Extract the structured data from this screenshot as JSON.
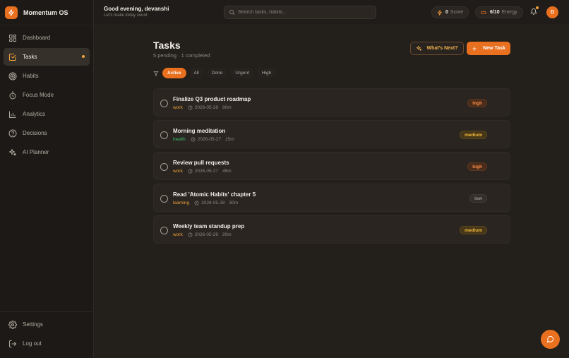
{
  "app": {
    "name": "Momentum OS"
  },
  "sidebar": {
    "items": [
      {
        "label": "Dashboard",
        "icon": "dashboard-icon",
        "active": false
      },
      {
        "label": "Tasks",
        "icon": "tasks-icon",
        "active": true
      },
      {
        "label": "Habits",
        "icon": "target-icon",
        "active": false
      },
      {
        "label": "Focus Mode",
        "icon": "timer-icon",
        "active": false
      },
      {
        "label": "Analytics",
        "icon": "analytics-icon",
        "active": false
      },
      {
        "label": "Decisions",
        "icon": "help-circle-icon",
        "active": false
      },
      {
        "label": "AI Planner",
        "icon": "sparkles-icon",
        "active": false
      }
    ],
    "bottom": [
      {
        "label": "Settings",
        "icon": "gear-icon"
      },
      {
        "label": "Log out",
        "icon": "logout-icon"
      }
    ]
  },
  "header": {
    "greeting": "Good evening, devanshi",
    "subtitle": "Let's make today count",
    "search_placeholder": "Search tasks, habits...",
    "score_value": "0",
    "score_label": "Score",
    "energy_value": "6/10",
    "energy_label": "Energy",
    "avatar_initial": "D"
  },
  "main": {
    "title": "Tasks",
    "subtitle": "5 pending · 1 completed",
    "whats_next_label": "What's Next?",
    "new_task_label": "New Task",
    "filters": [
      {
        "label": "Active",
        "active": true
      },
      {
        "label": "All",
        "active": false
      },
      {
        "label": "Done",
        "active": false
      },
      {
        "label": "Urgent",
        "active": false
      },
      {
        "label": "High",
        "active": false
      }
    ],
    "tasks": [
      {
        "title": "Finalize Q3 product roadmap",
        "category": "work",
        "date": "2026-05-28",
        "duration": "90m",
        "priority": "high"
      },
      {
        "title": "Morning meditation",
        "category": "health",
        "date": "2026-05-27",
        "duration": "15m",
        "priority": "medium"
      },
      {
        "title": "Review pull requests",
        "category": "work",
        "date": "2026-05-27",
        "duration": "45m",
        "priority": "high"
      },
      {
        "title": "Read 'Atomic Habits' chapter 5",
        "category": "learning",
        "date": "2026-05-28",
        "duration": "30m",
        "priority": "low"
      },
      {
        "title": "Weekly team standup prep",
        "category": "work",
        "date": "2026-05-29",
        "duration": "20m",
        "priority": "medium"
      }
    ]
  },
  "colors": {
    "accent": "#e8701f",
    "work": "#f2a33a",
    "health": "#3fbf6a",
    "learning": "#f2a33a"
  }
}
